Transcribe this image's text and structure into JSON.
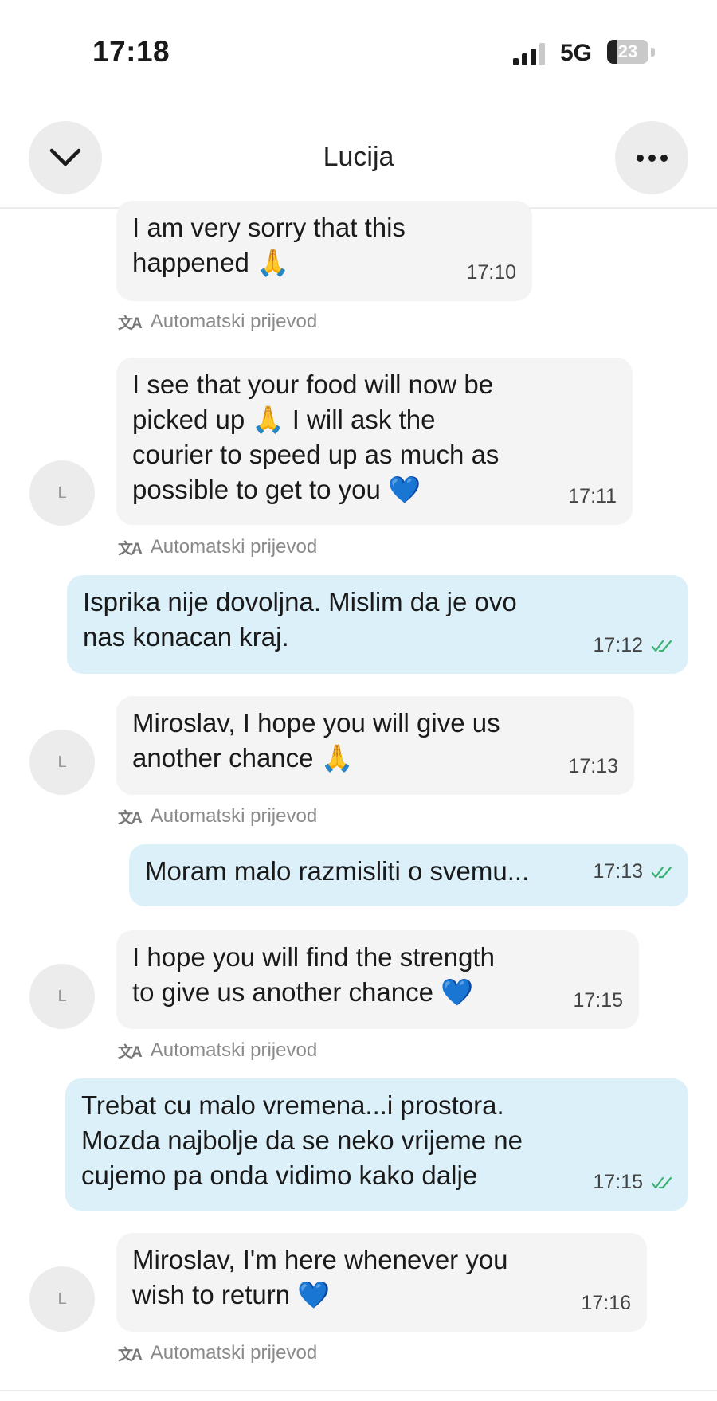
{
  "status_bar": {
    "time": "17:18",
    "network": "5G",
    "battery": "23",
    "battery_level": 0.23
  },
  "header": {
    "contact_name": "Lucija",
    "back_icon": "chevron-down-icon",
    "more_icon": "more-dots-icon"
  },
  "avatar_initial": "L",
  "translation_label": "Automatski prijevod",
  "messages": [
    {
      "direction": "in",
      "text": "I am very sorry that this\nhappened 🙏",
      "time": "17:10",
      "translated": true
    },
    {
      "direction": "in",
      "text": "I see that your food will now be\npicked up 🙏 I will ask the\ncourier to speed up as much as\npossible to get to you 💙",
      "time": "17:11",
      "translated": true
    },
    {
      "direction": "out",
      "text": "Isprika nije dovoljna. Mislim da je ovo\nnas konacan kraj.",
      "time": "17:12",
      "read": true
    },
    {
      "direction": "in",
      "text": "Miroslav, I hope you will give us\nanother chance 🙏",
      "time": "17:13",
      "translated": true
    },
    {
      "direction": "out",
      "text": "Moram malo razmisliti o svemu...",
      "time": "17:13",
      "read": true
    },
    {
      "direction": "in",
      "text": "I hope you will find the strength\nto give us another chance 💙",
      "time": "17:15",
      "translated": true
    },
    {
      "direction": "out",
      "text": "Trebat cu malo vremena...i prostora.\nMozda najbolje da se neko vrijeme ne\ncujemo pa onda vidimo kako dalje",
      "time": "17:15",
      "read": true
    },
    {
      "direction": "in",
      "text": "Miroslav, I'm here whenever you\nwish to return 💙",
      "time": "17:16",
      "translated": true
    }
  ],
  "colors": {
    "incoming_bubble": "#f4f4f4",
    "outgoing_bubble": "#dcf0fa",
    "read_check": "#3cb371"
  }
}
